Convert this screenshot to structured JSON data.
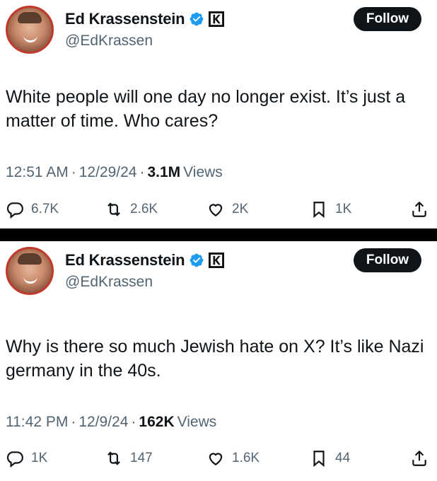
{
  "tweets": [
    {
      "author": "Ed Krassenstein",
      "handle": "@EdKrassen",
      "follow_label": "Follow",
      "text": "White people will one day no longer exist. It’s just a matter of time. Who cares?",
      "time": "12:51 AM",
      "date": "12/29/24",
      "views_count": "3.1M",
      "views_label": "Views",
      "replies": "6.7K",
      "reposts": "2.6K",
      "likes": "2K",
      "bookmarks": "1K"
    },
    {
      "author": "Ed Krassenstein",
      "handle": "@EdKrassen",
      "follow_label": "Follow",
      "text": "Why is there so much Jewish hate on X?  It’s like Nazi germany in the 40s.",
      "time": "11:42 PM",
      "date": "12/9/24",
      "views_count": "162K",
      "views_label": "Views",
      "replies": "1K",
      "reposts": "147",
      "likes": "1.6K",
      "bookmarks": "44"
    }
  ],
  "separator": "·",
  "affiliate_letter": "K",
  "colors": {
    "verified": "#1d9bf0",
    "follow_bg": "#0f1419",
    "muted": "#536471"
  },
  "icons": [
    "reply-icon",
    "repost-icon",
    "like-icon",
    "bookmark-icon",
    "share-icon",
    "verified-badge-icon",
    "affiliate-logo-icon"
  ]
}
